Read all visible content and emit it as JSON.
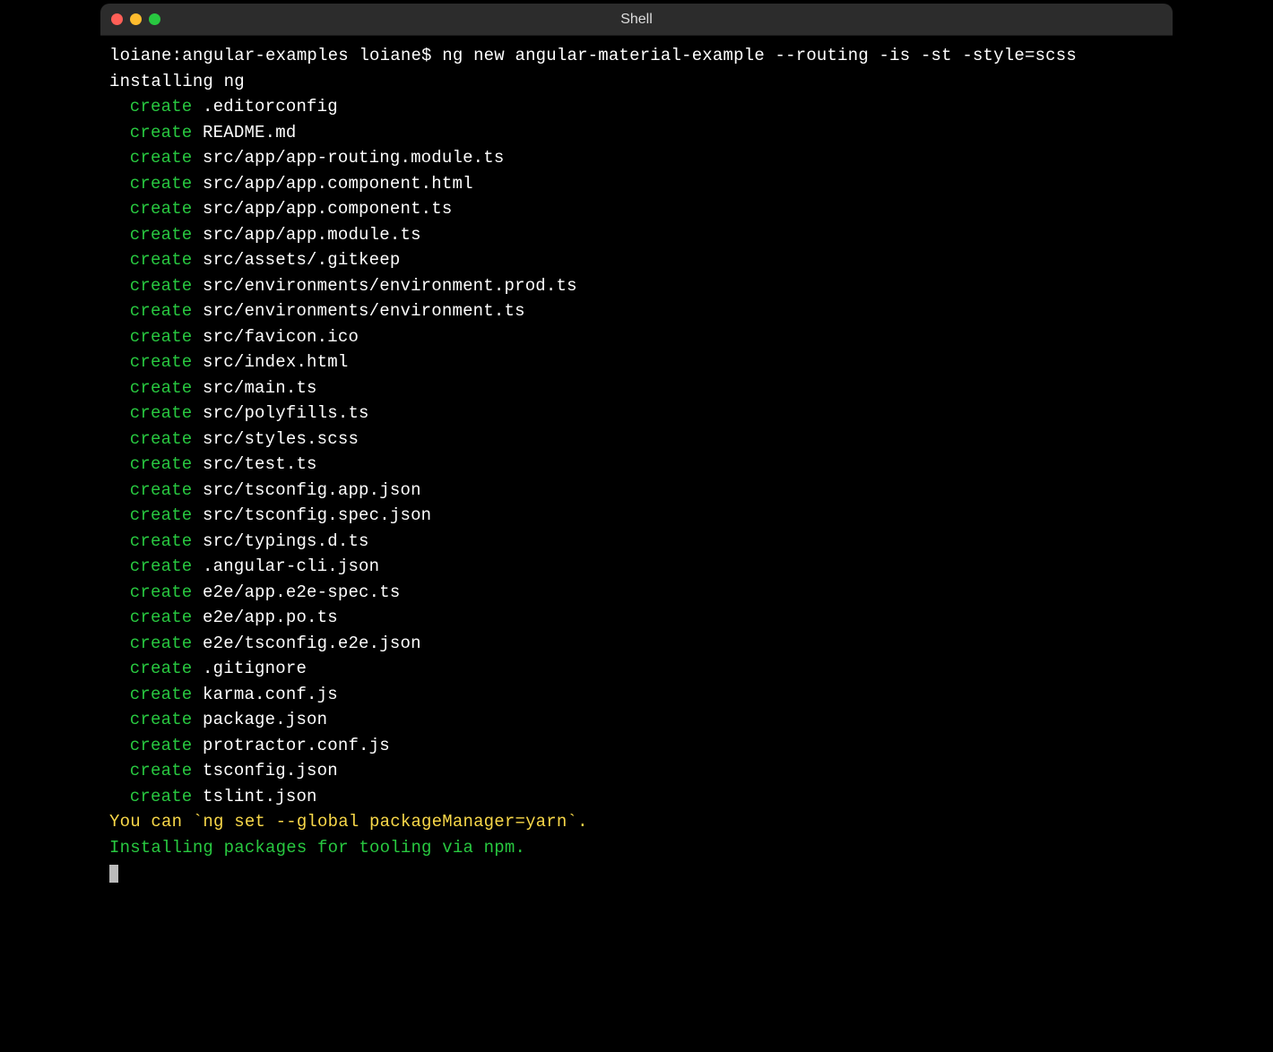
{
  "window": {
    "title": "Shell"
  },
  "terminal": {
    "prompt": "loiane:angular-examples loiane$ ng new angular-material-example --routing -is -st -style=scss",
    "installing": "installing ng",
    "create_label": "create",
    "files": [
      ".editorconfig",
      "README.md",
      "src/app/app-routing.module.ts",
      "src/app/app.component.html",
      "src/app/app.component.ts",
      "src/app/app.module.ts",
      "src/assets/.gitkeep",
      "src/environments/environment.prod.ts",
      "src/environments/environment.ts",
      "src/favicon.ico",
      "src/index.html",
      "src/main.ts",
      "src/polyfills.ts",
      "src/styles.scss",
      "src/test.ts",
      "src/tsconfig.app.json",
      "src/tsconfig.spec.json",
      "src/typings.d.ts",
      ".angular-cli.json",
      "e2e/app.e2e-spec.ts",
      "e2e/app.po.ts",
      "e2e/tsconfig.e2e.json",
      ".gitignore",
      "karma.conf.js",
      "package.json",
      "protractor.conf.js",
      "tsconfig.json",
      "tslint.json"
    ],
    "hint": "You can `ng set --global packageManager=yarn`.",
    "status": "Installing packages for tooling via npm."
  }
}
